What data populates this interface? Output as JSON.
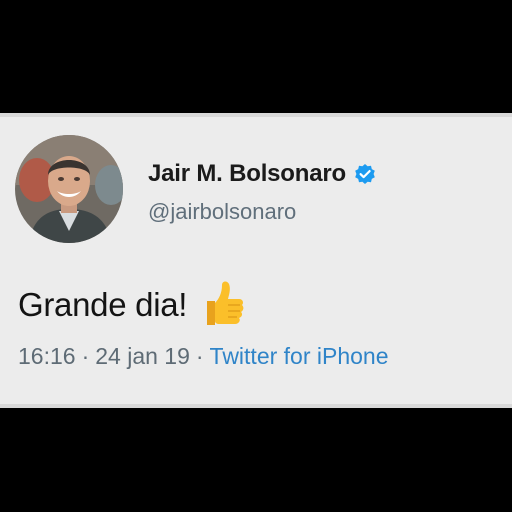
{
  "tweet": {
    "author": {
      "name": "Jair M. Bolsonaro",
      "handle": "@jairbolsonaro",
      "verified": true
    },
    "text": "Grande dia!",
    "emoji": "thumbs-up",
    "time": "16:16",
    "date": "24 jan 19",
    "separator": "·",
    "source": "Twitter for iPhone"
  },
  "colors": {
    "background": "#000000",
    "card": "#ececec",
    "name": "#1b1b1b",
    "muted": "#5e6b75",
    "link": "#2f84c8",
    "verified": "#1d9bf0"
  }
}
